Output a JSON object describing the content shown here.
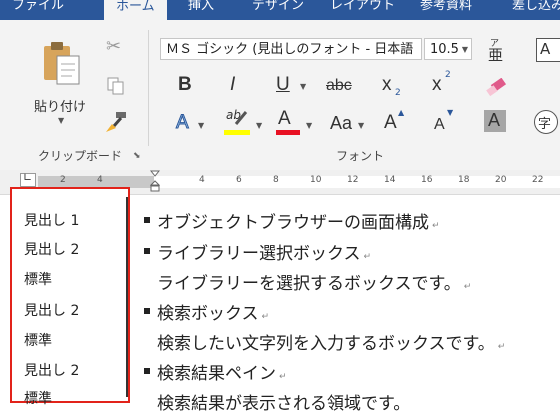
{
  "ribbon_tabs": [
    {
      "label": "ファイル"
    },
    {
      "label": "ホーム"
    },
    {
      "label": "挿入"
    },
    {
      "label": "デザイン"
    },
    {
      "label": "レイアウト"
    },
    {
      "label": "参考資料"
    },
    {
      "label": "差し込み"
    }
  ],
  "clipboard": {
    "paste_label": "貼り付け",
    "group_label": "クリップボード"
  },
  "font": {
    "name_value": "ＭＳ ゴシック (見出しのフォント - 日本語",
    "size_value": "10.5",
    "group_label": "フォント",
    "bold": "B",
    "italic": "I",
    "underline": "U",
    "strike": "abc",
    "subscript": "x",
    "sub_mark": "2",
    "superscript": "x",
    "sup_mark": "2",
    "text_effects": "A",
    "highlight": "ab",
    "font_color": "A",
    "change_case": "Aa",
    "grow": "A",
    "shrink": "A",
    "char_shading": "A",
    "enclosed": "字",
    "phonetic": "ア",
    "phonetic_sub": "亜"
  },
  "colors": {
    "accent": "#2b579a",
    "highlight_yellow": "#ffff00",
    "font_red": "#e81123",
    "nav_border": "#e2231a"
  },
  "ruler_ticks": [
    "2",
    "4",
    "2",
    "4",
    "6",
    "8",
    "10",
    "12",
    "14",
    "16",
    "18",
    "20",
    "22"
  ],
  "nav_pane": {
    "items": [
      {
        "label": "見出し 1"
      },
      {
        "label": "見出し 2"
      },
      {
        "label": "標準"
      },
      {
        "label": "見出し 2"
      },
      {
        "label": "標準"
      },
      {
        "label": "見出し 2"
      },
      {
        "label": "標準"
      }
    ]
  },
  "document": {
    "lines": [
      {
        "text": "オブジェクトブラウザーの画面構成",
        "bullet": true
      },
      {
        "text": "ライブラリー選択ボックス",
        "bullet": true
      },
      {
        "text": "ライブラリーを選択するボックスです。",
        "bullet": false
      },
      {
        "text": "検索ボックス",
        "bullet": true
      },
      {
        "text": "検索したい文字列を入力するボックスです。",
        "bullet": false
      },
      {
        "text": "検索結果ペイン",
        "bullet": true
      },
      {
        "text": "検索結果が表示される領域です。",
        "bullet": false
      }
    ],
    "para_mark": "↵"
  }
}
